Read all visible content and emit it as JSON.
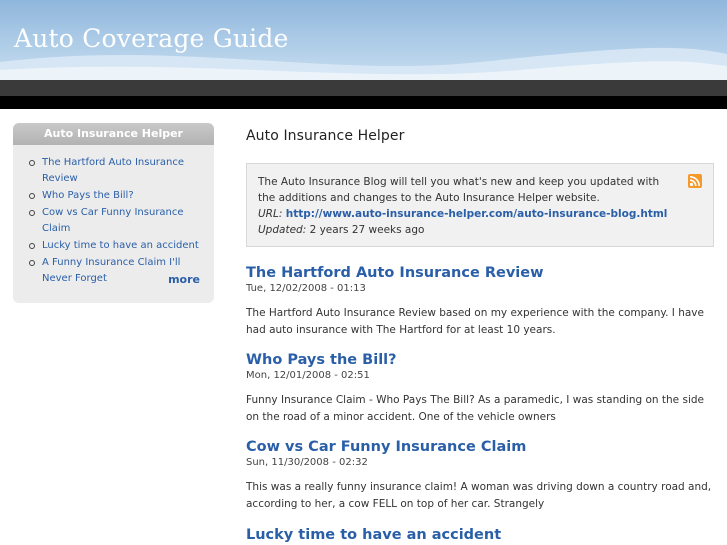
{
  "header": {
    "site_title": "Auto Coverage Guide"
  },
  "sidebar": {
    "block_title": "Auto Insurance Helper",
    "items": [
      {
        "label": "The Hartford Auto Insurance Review"
      },
      {
        "label": "Who Pays the Bill?"
      },
      {
        "label": "Cow vs Car Funny Insurance Claim"
      },
      {
        "label": "Lucky time to have an accident"
      },
      {
        "label": "A Funny Insurance Claim I'll Never Forget"
      }
    ],
    "more_label": "more"
  },
  "main": {
    "page_title": "Auto Insurance Helper",
    "feed": {
      "description": "The Auto Insurance Blog will tell you what's new and keep you updated with the additions and changes to the Auto Insurance Helper website.",
      "url_label": "URL:",
      "url": "http://www.auto-insurance-helper.com/auto-insurance-blog.html",
      "updated_label": "Updated:",
      "updated": "2 years 27 weeks ago",
      "rss_icon": "rss-feed-icon",
      "rss_color": "#f59a2a"
    },
    "posts": [
      {
        "title": "The Hartford Auto Insurance Review",
        "date": "Tue, 12/02/2008 - 01:13",
        "teaser": "The Hartford Auto Insurance Review based on my experience with the company. I have had auto insurance with The Hartford for at least 10 years."
      },
      {
        "title": "Who Pays the Bill?",
        "date": "Mon, 12/01/2008 - 02:51",
        "teaser": "Funny Insurance Claim - Who Pays The Bill? As a paramedic, I was standing on the side on the road of a minor accident. One of the vehicle owners"
      },
      {
        "title": "Cow vs Car Funny Insurance Claim",
        "date": "Sun, 11/30/2008 - 02:32",
        "teaser": "This was a really funny insurance claim! A woman was driving down a country road and, according to her, a cow FELL on top of her car. Strangely"
      },
      {
        "title": "Lucky time to have an accident",
        "date": "",
        "teaser": ""
      }
    ]
  },
  "colors": {
    "link": "#2a5fa8",
    "header_top": "#8fb6db",
    "nav_bar": "#3a3a3a"
  }
}
